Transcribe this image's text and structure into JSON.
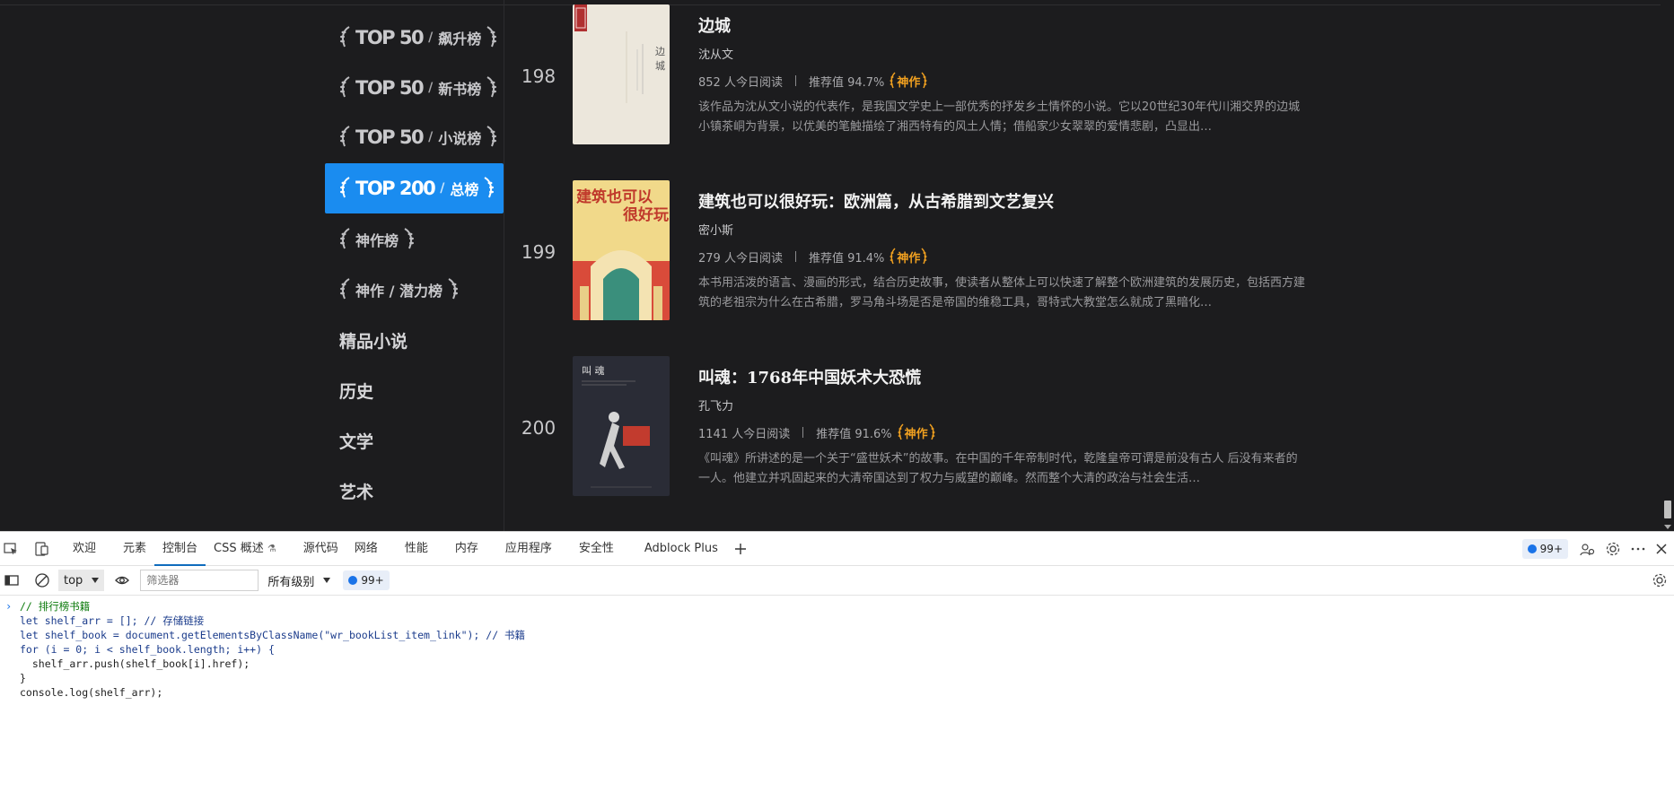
{
  "sidebar": {
    "items": [
      {
        "kind": "top",
        "badge": "TOP 50",
        "sub": "飙升榜",
        "active": false
      },
      {
        "kind": "top",
        "badge": "TOP 50",
        "sub": "新书榜",
        "active": false
      },
      {
        "kind": "top",
        "badge": "TOP 50",
        "sub": "小说榜",
        "active": false
      },
      {
        "kind": "top",
        "badge": "TOP 200",
        "sub": "总榜",
        "active": true
      },
      {
        "kind": "wreath",
        "sub": "神作榜",
        "active": false
      },
      {
        "kind": "wreath",
        "sub": "神作 / 潜力榜",
        "active": false
      },
      {
        "kind": "plain",
        "sub": "精品小说",
        "active": false
      },
      {
        "kind": "plain",
        "sub": "历史",
        "active": false
      },
      {
        "kind": "plain",
        "sub": "文学",
        "active": false
      },
      {
        "kind": "plain",
        "sub": "艺术",
        "active": false
      }
    ]
  },
  "books": [
    {
      "rank": "198",
      "title": "边城",
      "author": "沈从文",
      "readers": "852 人今日阅读",
      "recommend": "推荐值 94.7%",
      "badge": "神作",
      "desc": "该作品为沈从文小说的代表作，是我国文学史上一部优秀的抒发乡土情怀的小说。它以20世纪30年代川湘交界的边城小镇茶峒为背景，以优美的笔触描绘了湘西特有的风土人情；借船家少女翠翠的爱情悲剧，凸显出…",
      "cover_title": "边城",
      "cover_colors": [
        "#ece7dc",
        "#b03030"
      ]
    },
    {
      "rank": "199",
      "title": "建筑也可以很好玩：欧洲篇，从古希腊到文艺复兴",
      "author": "密小斯",
      "readers": "279 人今日阅读",
      "recommend": "推荐值 91.4%",
      "badge": "神作",
      "desc": "本书用活泼的语言、漫画的形式，结合历史故事，使读者从整体上可以快速了解整个欧洲建筑的发展历史，包括西方建筑的老祖宗为什么在古希腊，罗马角斗场是否是帝国的维稳工具，哥特式大教堂怎么就成了黑暗化…",
      "cover_title": "建筑也可以很好玩",
      "cover_colors": [
        "#f1d98a",
        "#d94b3a"
      ]
    },
    {
      "rank": "200",
      "title": "叫魂：1768年中国妖术大恐慌",
      "author": "孔飞力",
      "readers": "1141 人今日阅读",
      "recommend": "推荐值 91.6%",
      "badge": "神作",
      "desc": "《叫魂》所讲述的是一个关于“盛世妖术”的故事。在中国的千年帝制时代，乾隆皇帝可谓是前没有古人 后没有来者的一人。他建立并巩固起来的大清帝国达到了权力与威望的巅峰。然而整个大清的政治与社会生活…",
      "cover_title": "叫魂",
      "cover_colors": [
        "#2a2c36",
        "#c23b2e"
      ]
    }
  ],
  "devtools": {
    "tabs": [
      "欢迎",
      "元素",
      "控制台",
      "CSS 概述",
      "源代码",
      "网络",
      "性能",
      "内存",
      "应用程序",
      "安全性",
      "Adblock Plus"
    ],
    "active_tab": "控制台",
    "message_count": "99+",
    "context": "top",
    "filter_placeholder": "筛选器",
    "level": "所有级别",
    "toolbar_count": "99+"
  },
  "console": {
    "lines": [
      "// 排行榜书籍",
      "let shelf_arr = []; // 存储链接",
      "let shelf_book = document.getElementsByClassName(\"wr_bookList_item_link\"); // 书籍",
      "for (i = 0; i < shelf_book.length; i++) {",
      "  shelf_arr.push(shelf_book[i].href);",
      "}",
      "console.log(shelf_arr);"
    ]
  },
  "colors": {
    "page_bg": "#1c1c1e",
    "active_blue": "#1a8cf0",
    "badge_gold": "#f0a020",
    "devtools_accent": "#0f6cbd"
  }
}
